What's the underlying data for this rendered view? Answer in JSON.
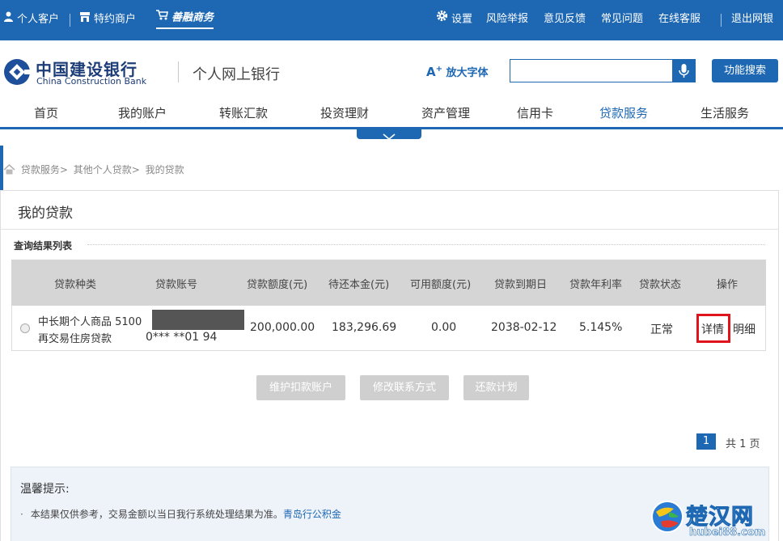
{
  "topbar": {
    "personal": "个人客户",
    "merchant": "特约商户",
    "shanrong": "善融商务",
    "settings": "设置",
    "risk_report": "风险举报",
    "feedback": "意见反馈",
    "faq": "常见问题",
    "online_service": "在线客服",
    "logout": "退出网银"
  },
  "brand": {
    "name_cn": "中国建设银行",
    "name_en": "China Construction Bank",
    "product": "个人网上银行",
    "font_toggle": "放大字体",
    "func_search": "功能搜索"
  },
  "nav": {
    "items": [
      "首页",
      "我的账户",
      "转账汇款",
      "投资理财",
      "资产管理",
      "信用卡",
      "贷款服务",
      "生活服务"
    ],
    "active_index": 6
  },
  "breadcrumb": [
    "贷款服务>",
    "其他个人贷款>",
    "我的贷款"
  ],
  "page": {
    "title": "我的贷款",
    "section": "查询结果列表"
  },
  "table": {
    "headers": [
      "贷款种类",
      "贷款账号",
      "贷款额度(元)",
      "待还本金(元)",
      "可用额度(元)",
      "贷款到期日",
      "贷款年利率",
      "贷款状态",
      "操作"
    ],
    "rows": [
      {
        "type_line1": "中长期个人商品 5100",
        "type_line2": "再交易住房贷款",
        "account": "0*** **01 94",
        "limit": "200,000.00",
        "outstanding": "183,296.69",
        "available": "0.00",
        "due_date": "2038-02-12",
        "rate": "5.145%",
        "status": "正常",
        "action_detail": "详情",
        "action_statement": "明细"
      }
    ]
  },
  "buttons": {
    "maintain_account": "维护扣款账户",
    "modify_contact": "修改联系方式",
    "repay_plan": "还款计划"
  },
  "pagination": {
    "current": "1",
    "total": "共 1 页"
  },
  "tip": {
    "title": "温馨提示:",
    "text": "本结果仅供参考，交易金额以当日我行系统处理结果为准。",
    "source": "青岛行公积金"
  },
  "watermark": {
    "cn": "楚汉网",
    "en": "hubei88.com"
  },
  "colors": {
    "brand_blue": "#1d67b3",
    "highlight_red": "#e0141d"
  }
}
